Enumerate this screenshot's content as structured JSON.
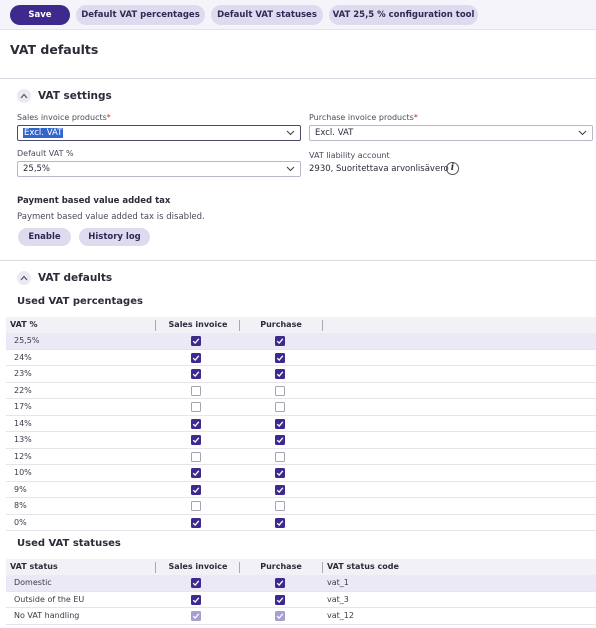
{
  "toolbar": {
    "save": "Save",
    "default_vat_percentages": "Default VAT percentages",
    "default_vat_statuses": "Default VAT statuses",
    "config_tool": "VAT 25,5 % configuration tool"
  },
  "page": {
    "title": "VAT defaults"
  },
  "vat_settings": {
    "title": "VAT settings",
    "sales_label": "Sales invoice products",
    "sales_value": "Excl. VAT",
    "purchase_label": "Purchase invoice products",
    "purchase_value": "Excl. VAT",
    "default_vat_label": "Default VAT %",
    "default_vat_value": "25,5%",
    "liability_label": "VAT liability account",
    "liability_value": "2930, Suoritettava arvonlisävero",
    "required_mark": "*",
    "info_icon": "i"
  },
  "payment_based": {
    "title": "Payment based value added tax",
    "text": "Payment based value added tax is disabled.",
    "enable": "Enable",
    "history": "History log"
  },
  "vat_defaults": {
    "title": "VAT defaults",
    "percentages_title": "Used VAT percentages",
    "percentages_headers": {
      "vat": "VAT %",
      "sales": "Sales invoice",
      "purchase": "Purchase"
    },
    "percentages": [
      {
        "label": "25,5%",
        "sales": true,
        "purchase": true
      },
      {
        "label": "24%",
        "sales": true,
        "purchase": true
      },
      {
        "label": "23%",
        "sales": true,
        "purchase": true
      },
      {
        "label": "22%",
        "sales": false,
        "purchase": false
      },
      {
        "label": "17%",
        "sales": false,
        "purchase": false
      },
      {
        "label": "14%",
        "sales": true,
        "purchase": true
      },
      {
        "label": "13%",
        "sales": true,
        "purchase": true
      },
      {
        "label": "12%",
        "sales": false,
        "purchase": false
      },
      {
        "label": "10%",
        "sales": true,
        "purchase": true
      },
      {
        "label": "9%",
        "sales": true,
        "purchase": true
      },
      {
        "label": "8%",
        "sales": false,
        "purchase": false
      },
      {
        "label": "0%",
        "sales": true,
        "purchase": true
      }
    ],
    "statuses_title": "Used VAT statuses",
    "statuses_headers": {
      "status": "VAT status",
      "sales": "Sales invoice",
      "purchase": "Purchase",
      "code": "VAT status code"
    },
    "statuses": [
      {
        "label": "Domestic",
        "sales": true,
        "purchase": true,
        "code": "vat_1",
        "disabled": false
      },
      {
        "label": "Outside of the EU",
        "sales": true,
        "purchase": true,
        "code": "vat_3",
        "disabled": false
      },
      {
        "label": "No VAT handling",
        "sales": true,
        "purchase": true,
        "code": "vat_12",
        "disabled": true
      }
    ]
  },
  "colors": {
    "primary": "#3d2a8c",
    "pill": "#dedbee",
    "row_highlight": "#ebe9f5"
  },
  "icons": [
    "chevron-up-icon",
    "chevron-down-icon",
    "info-icon",
    "checkbox-checked-icon"
  ]
}
